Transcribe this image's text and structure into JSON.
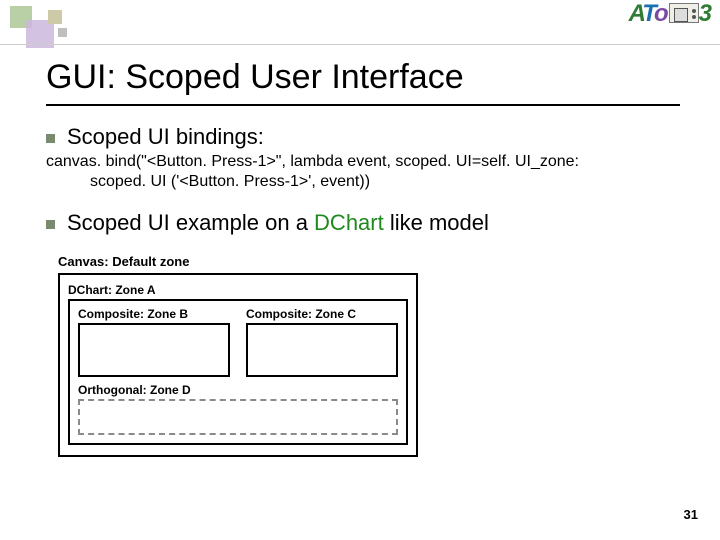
{
  "logo": {
    "text_parts": [
      "A",
      "T",
      "o",
      "3"
    ]
  },
  "title": "GUI: Scoped User Interface",
  "bullets": {
    "b1": "Scoped UI bindings:",
    "b2_prefix": "Scoped UI example on a ",
    "b2_highlight": "DChart",
    "b2_suffix": " like model"
  },
  "code": {
    "line1": "canvas. bind(\"<Button. Press-1>\", lambda event, scoped. UI=self. UI_zone:",
    "line2": "scoped. UI ('<Button. Press-1>', event))"
  },
  "diagram": {
    "canvas": "Canvas: Default zone",
    "dchart": "DChart: Zone A",
    "compB": "Composite: Zone B",
    "compC": "Composite: Zone C",
    "orth": "Orthogonal: Zone D"
  },
  "page": "31"
}
